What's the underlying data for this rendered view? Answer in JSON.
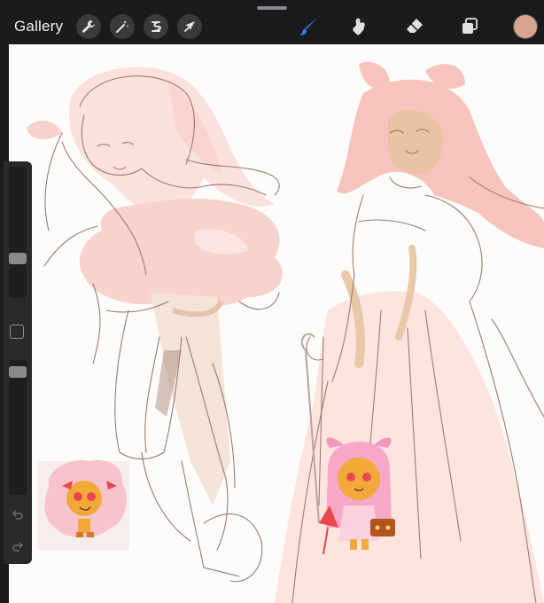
{
  "toolbar": {
    "gallery_label": "Gallery",
    "left_tools": [
      "wrench-icon",
      "magic-wand-icon",
      "selection-icon",
      "transform-arrow-icon"
    ],
    "right_tools": [
      "brush-icon",
      "smudge-icon",
      "eraser-icon",
      "layers-icon"
    ],
    "active_tool": "brush-icon",
    "accent_color": "#2f7de1",
    "current_color": "#d9a38e"
  },
  "sidebar": {
    "brush_size_level": 0.28,
    "opacity_level": 0.95,
    "controls": [
      "modifier-button",
      "undo-icon",
      "redo-icon"
    ]
  },
  "canvas": {
    "background": "#fdfcfb",
    "sketch_stroke_color": "#9c7a6c",
    "pink_fill_color": "#f6c9c4",
    "skin_tone_color": "#e9c3a4"
  }
}
